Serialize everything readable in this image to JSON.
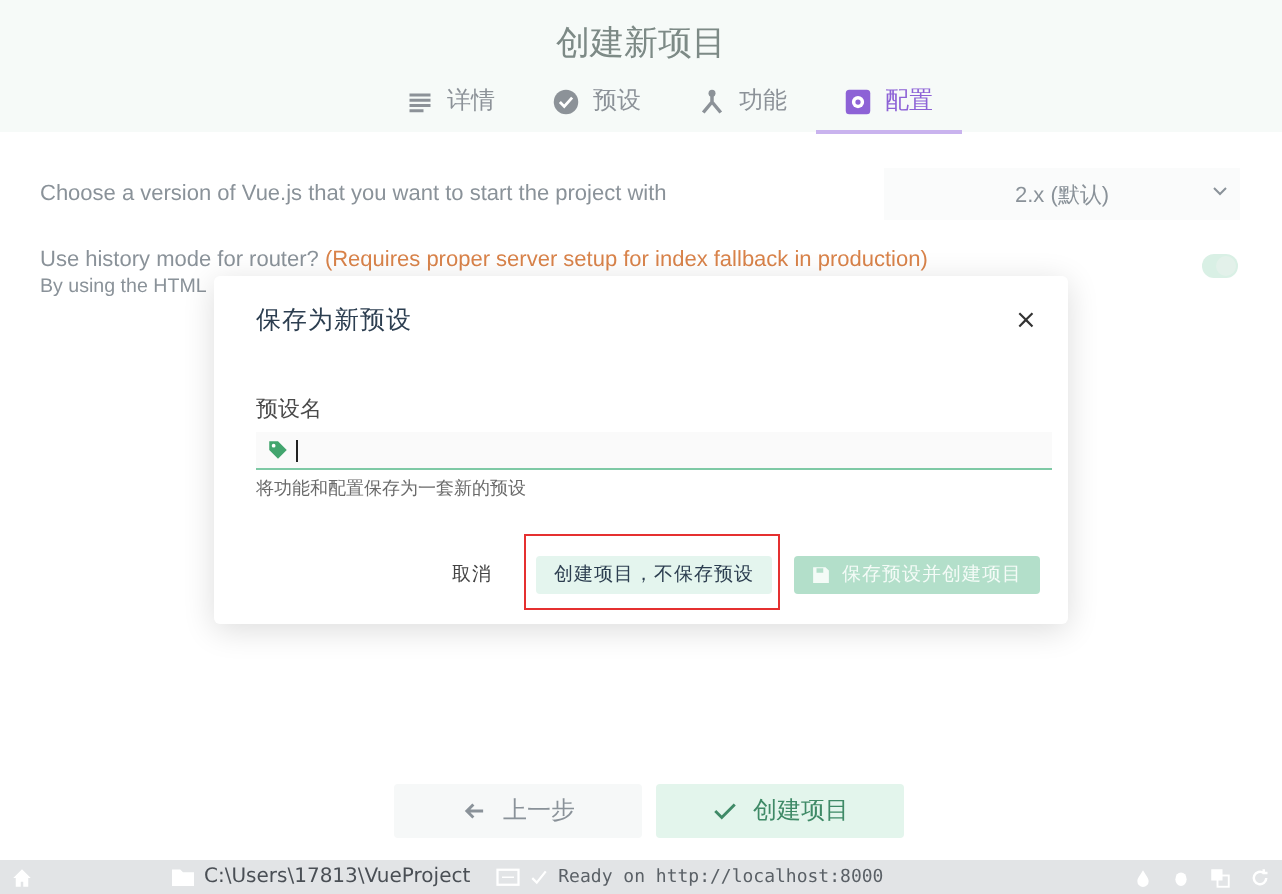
{
  "header": {
    "title": "创建新项目",
    "tabs": [
      {
        "label": "详情",
        "kind": "details",
        "selected": false
      },
      {
        "label": "预设",
        "kind": "preset",
        "selected": false
      },
      {
        "label": "功能",
        "kind": "features",
        "selected": false
      },
      {
        "label": "配置",
        "kind": "config",
        "selected": true
      }
    ]
  },
  "config": {
    "rows": [
      {
        "kind": "select",
        "label": "Choose a version of Vue.js that you want to start the project with",
        "value": "2.x (默认)"
      },
      {
        "kind": "toggle",
        "label": "Use history mode for router?",
        "note": "(Requires proper server setup for index fallback in production)",
        "description": "By using the HTML",
        "on": true
      }
    ]
  },
  "dialog": {
    "title": "保存为新预设",
    "close": "×",
    "field_label": "预设名",
    "hint": "将功能和配置保存为一套新的预设",
    "buttons": [
      {
        "kind": "text",
        "label": "取消",
        "disabled": false,
        "highlighted": false
      },
      {
        "kind": "secondary",
        "label": "创建项目，不保存预设",
        "disabled": false,
        "highlighted": true
      },
      {
        "kind": "primary",
        "label": "保存预设并创建项目",
        "disabled": true,
        "highlighted": false
      }
    ]
  },
  "footer": {
    "buttons": [
      {
        "kind": "back",
        "label": "上一步"
      },
      {
        "kind": "create",
        "label": "创建项目"
      }
    ]
  },
  "status_bar": {
    "path": "C:\\Users\\17813\\VueProject",
    "log": "Ready on http://localhost:8000"
  }
}
